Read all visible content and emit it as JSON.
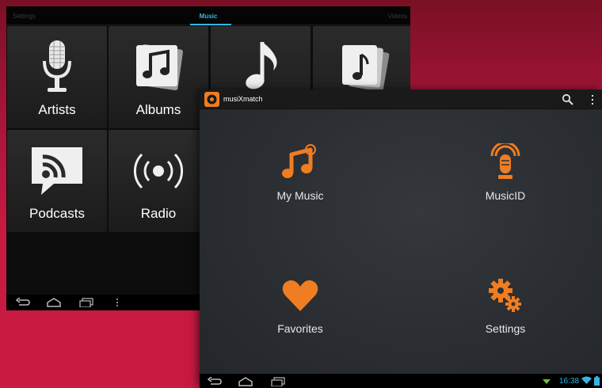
{
  "back_app": {
    "tabs": {
      "left": "Settings",
      "center": "Music",
      "right": "Videos"
    },
    "tiles": [
      {
        "label": "Artists",
        "icon": "microphone-icon"
      },
      {
        "label": "Albums",
        "icon": "album-icon"
      },
      {
        "label": "",
        "icon": "music-note-icon"
      },
      {
        "label": "",
        "icon": "playlists-icon"
      },
      {
        "label": "Podcasts",
        "icon": "podcast-icon"
      },
      {
        "label": "Radio",
        "icon": "radio-icon"
      }
    ],
    "accent_color": "#33b5e5"
  },
  "front_app": {
    "title": "musiXmatch",
    "accent_color": "#ef7d22",
    "menu": [
      {
        "label": "My Music",
        "icon": "music-notes-icon"
      },
      {
        "label": "MusicID",
        "icon": "microphone-icon"
      },
      {
        "label": "Favorites",
        "icon": "heart-icon"
      },
      {
        "label": "Settings",
        "icon": "gears-icon"
      }
    ],
    "status": {
      "time": "16:38"
    }
  },
  "background_color": "#c81a42"
}
